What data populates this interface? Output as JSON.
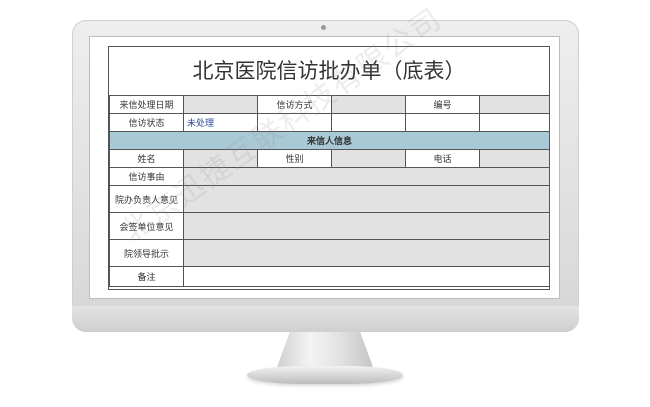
{
  "form": {
    "title": "北京医院信访批办单（底表）",
    "row1": {
      "label1": "来信处理日期",
      "value1": "",
      "label2": "信访方式",
      "value2": "",
      "label3": "编号",
      "value3": ""
    },
    "row2": {
      "label": "信访状态",
      "status": "未处理"
    },
    "section_title": "来信人信息",
    "row3": {
      "label1": "姓名",
      "label2": "性别",
      "label3": "电话"
    },
    "rows": {
      "matter": "信访事由",
      "dept_head": "院办负责人意见",
      "cosign": "会签单位意见",
      "leader": "院领导批示",
      "remark": "备注"
    }
  },
  "watermark": "北京迅捷互联科技有限公司"
}
